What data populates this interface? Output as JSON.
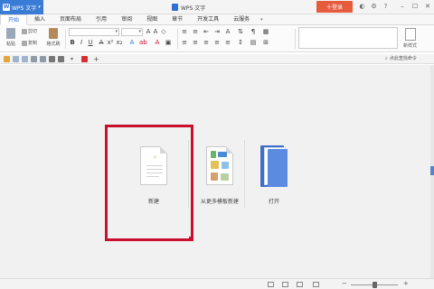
{
  "titlebar": {
    "app_name": "WPS 文字",
    "logo_letter": "W",
    "window_title": "WPS 文字",
    "signup_label": "十登录",
    "icons": [
      "skin-icon",
      "settings-icon",
      "help-icon"
    ],
    "window_buttons": [
      "minimize-icon",
      "maximize-icon",
      "close-icon"
    ]
  },
  "tabs": [
    {
      "label": "开始",
      "active": true
    },
    {
      "label": "插入"
    },
    {
      "label": "页面布局"
    },
    {
      "label": "引用"
    },
    {
      "label": "审阅"
    },
    {
      "label": "视图"
    },
    {
      "label": "章节"
    },
    {
      "label": "开发工具"
    },
    {
      "label": "云服务"
    }
  ],
  "ribbon": {
    "paste_label": "粘贴",
    "cut_label": "剪切",
    "copy_label": "复制",
    "format_painter_label": "格式刷",
    "styles_label": "新样式"
  },
  "quick_access": {
    "search_label": "点此查找命令"
  },
  "start_page": {
    "new_label": "新建",
    "template_label": "从更多模板新建",
    "open_label": "打开"
  },
  "colors": {
    "brand_blue": "#3a7bd5",
    "signup_red": "#e55b3c",
    "highlight_red": "#c8102e"
  }
}
